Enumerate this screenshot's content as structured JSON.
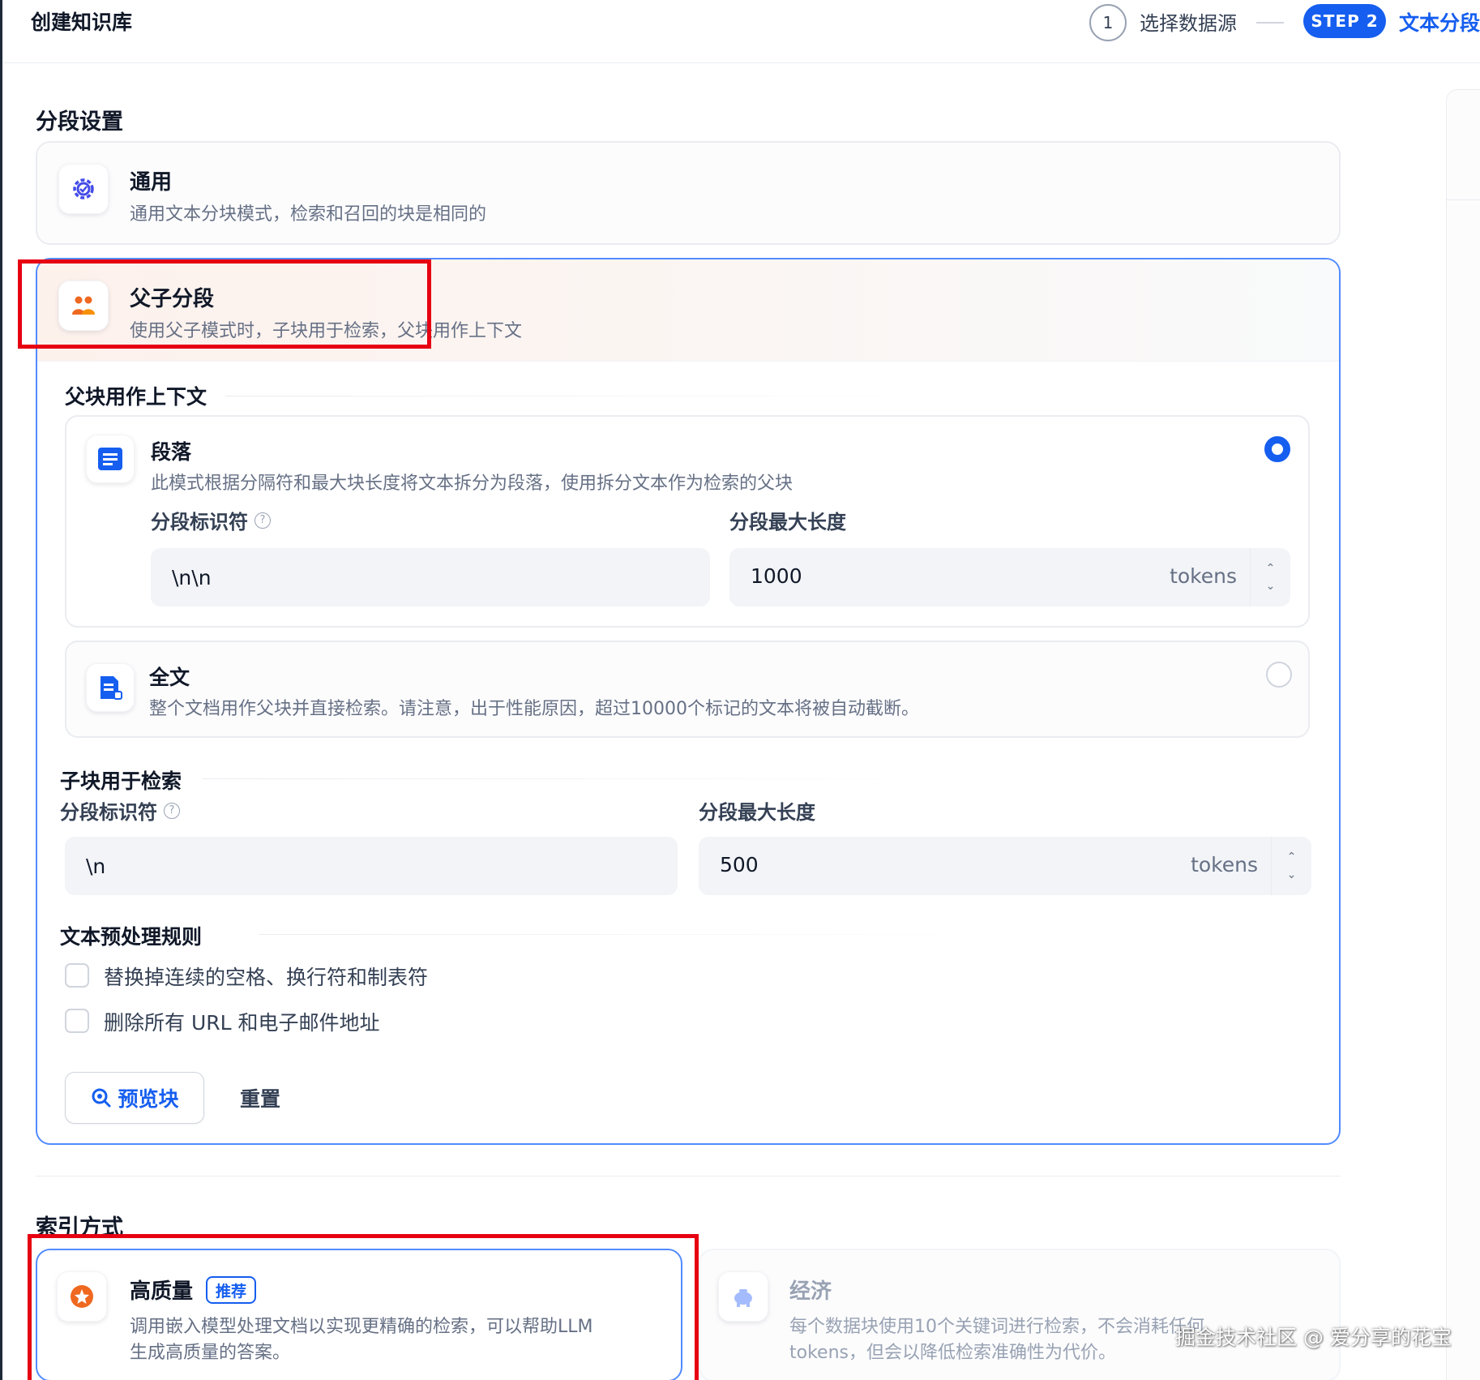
{
  "header": {
    "title": "创建知识库",
    "step1_number": "1",
    "step1_label": "选择数据源",
    "step2_badge": "STEP 2",
    "step2_label": "文本分段与"
  },
  "chunk_settings": {
    "title": "分段设置",
    "general": {
      "title": "通用",
      "desc": "通用文本分块模式，检索和召回的块是相同的"
    },
    "parent_child": {
      "title": "父子分段",
      "desc": "使用父子模式时，子块用于检索，父块用作上下文",
      "parent_section_title": "父块用作上下文",
      "paragraph": {
        "title": "段落",
        "desc": "此模式根据分隔符和最大块长度将文本拆分为段落，使用拆分文本作为检索的父块",
        "delimiter_label": "分段标识符",
        "delimiter_value": "\\n\\n",
        "max_length_label": "分段最大长度",
        "max_length_value": "1000",
        "unit": "tokens",
        "selected": true
      },
      "full_doc": {
        "title": "全文",
        "desc": "整个文档用作父块并直接检索。请注意，出于性能原因，超过10000个标记的文本将被自动截断。",
        "selected": false
      },
      "child_section_title": "子块用于检索",
      "child": {
        "delimiter_label": "分段标识符",
        "delimiter_value": "\\n",
        "max_length_label": "分段最大长度",
        "max_length_value": "500",
        "unit": "tokens"
      },
      "preprocess_title": "文本预处理规则",
      "rules": [
        {
          "label": "替换掉连续的空格、换行符和制表符",
          "checked": false
        },
        {
          "label": "删除所有 URL 和电子邮件地址",
          "checked": false
        }
      ],
      "preview_button": "预览块",
      "reset_button": "重置"
    }
  },
  "index_method": {
    "title": "索引方式",
    "high_quality": {
      "title": "高质量",
      "badge": "推荐",
      "desc_line1": "调用嵌入模型处理文档以实现更精确的检索，可以帮助LLM",
      "desc_line2": "生成高质量的答案。",
      "selected": true
    },
    "economy": {
      "title": "经济",
      "desc_line1": "每个数据块使用10个关键词进行检索，不会消耗任何",
      "desc_line2": "tokens，但会以降低检索准确性为代价。",
      "selected": false
    }
  },
  "watermark": "掘金技术社区 @ 爱分享的花宝",
  "colors": {
    "accent": "#155eef",
    "highlight_border": "#e60012",
    "parent_icon": "#ef6820",
    "general_icon": "#444ce7"
  },
  "icons": {
    "general": "gear-icon",
    "parent_child": "people-icon",
    "paragraph": "paragraph-icon",
    "full_doc": "document-icon",
    "preview": "search-icon",
    "high_quality": "star-icon",
    "economy": "piggy-bank-icon"
  }
}
